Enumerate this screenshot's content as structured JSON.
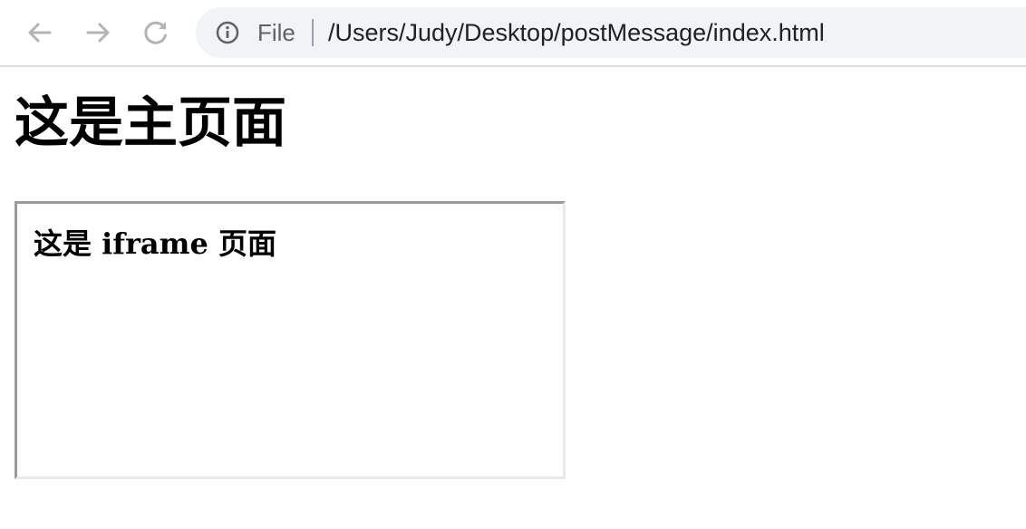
{
  "browser": {
    "scheme_label": "File",
    "url": "/Users/Judy/Desktop/postMessage/index.html",
    "icons": {
      "back": "arrow-left-icon",
      "forward": "arrow-right-icon",
      "reload": "reload-icon",
      "page_info": "info-icon"
    },
    "colors": {
      "icon": "#b4b4b4",
      "omnibox_bg": "#f1f3f4"
    }
  },
  "page": {
    "heading": "这是主页面",
    "iframe": {
      "heading": "这是 iframe 页面"
    }
  }
}
